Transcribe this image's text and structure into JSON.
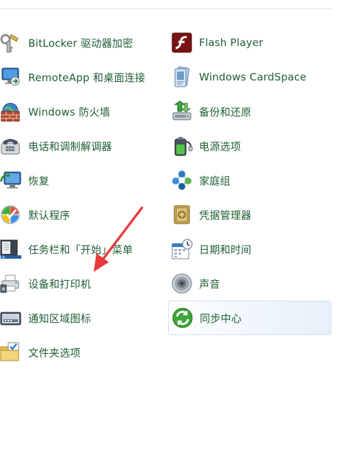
{
  "left_items": [
    {
      "label": "BitLocker 驱动器加密",
      "icon": "bitlocker-key-icon"
    },
    {
      "label": "RemoteApp 和桌面连接",
      "icon": "remoteapp-monitor-icon"
    },
    {
      "label": "Windows 防火墙",
      "icon": "firewall-brick-globe-icon"
    },
    {
      "label": "电话和调制解调器",
      "icon": "telephone-modem-icon"
    },
    {
      "label": "恢复",
      "icon": "recovery-monitor-icon"
    },
    {
      "label": "默认程序",
      "icon": "default-programs-icon"
    },
    {
      "label": "任务栏和「开始」菜单",
      "icon": "taskbar-start-menu-icon"
    },
    {
      "label": "设备和打印机",
      "icon": "devices-printers-icon"
    },
    {
      "label": "通知区域图标",
      "icon": "notification-area-icon"
    },
    {
      "label": "文件夹选项",
      "icon": "folder-options-icon"
    }
  ],
  "right_items": [
    {
      "label": "Flash Player",
      "icon": "flash-player-icon"
    },
    {
      "label": "Windows CardSpace",
      "icon": "cardspace-icon"
    },
    {
      "label": "备份和还原",
      "icon": "backup-restore-icon"
    },
    {
      "label": "电源选项",
      "icon": "power-options-battery-icon"
    },
    {
      "label": "家庭组",
      "icon": "homegroup-icon"
    },
    {
      "label": "凭据管理器",
      "icon": "credential-manager-vault-icon"
    },
    {
      "label": "日期和时间",
      "icon": "date-time-calendar-clock-icon"
    },
    {
      "label": "声音",
      "icon": "sound-speaker-icon"
    },
    {
      "label": "同步中心",
      "icon": "sync-center-icon"
    }
  ],
  "annotation": {
    "arrow_color": "#e8393b",
    "points_to": "设备和打印机"
  },
  "colors": {
    "link_text": "#1e5e33",
    "hover_border": "#cfe0f0"
  }
}
